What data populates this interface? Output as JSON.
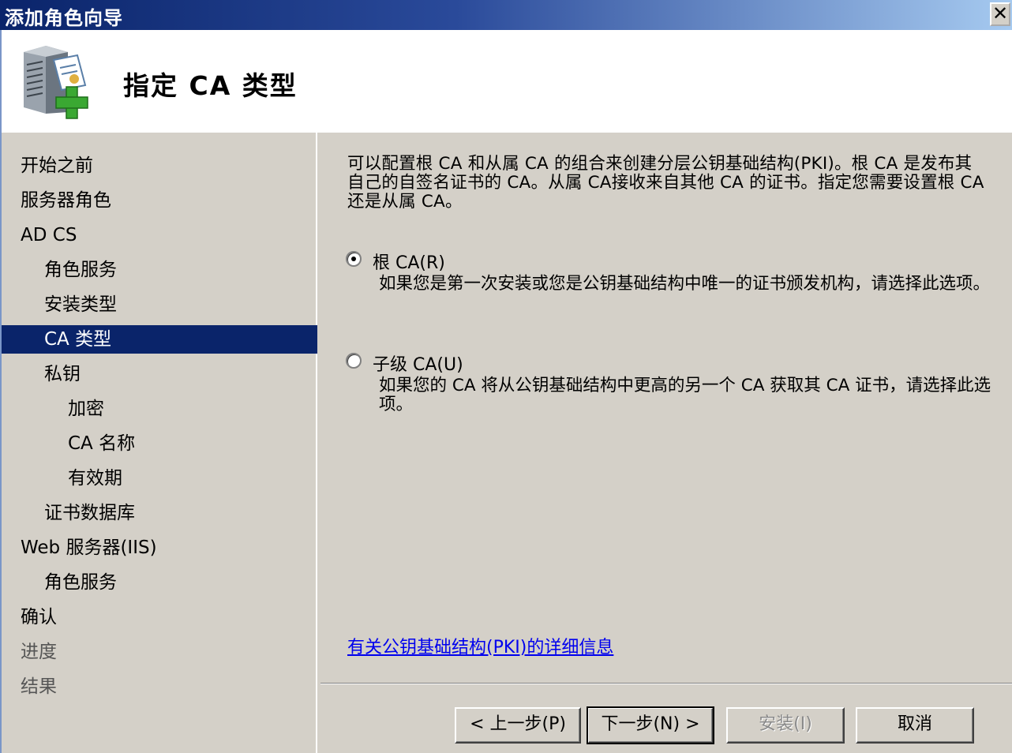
{
  "window": {
    "title": "添加角色向导",
    "close_glyph": "✕"
  },
  "header": {
    "title": "指定 CA 类型",
    "icon": "server-add-icon"
  },
  "nav": {
    "items": [
      {
        "label": "开始之前"
      },
      {
        "label": "服务器角色"
      },
      {
        "label": "AD CS"
      },
      {
        "label": "角色服务"
      },
      {
        "label": "安装类型"
      },
      {
        "label": "CA 类型"
      },
      {
        "label": "私钥"
      },
      {
        "label": "加密"
      },
      {
        "label": "CA 名称"
      },
      {
        "label": "有效期"
      },
      {
        "label": "证书数据库"
      },
      {
        "label": "Web 服务器(IIS)"
      },
      {
        "label": "角色服务"
      },
      {
        "label": "确认"
      },
      {
        "label": "进度"
      },
      {
        "label": "结果"
      }
    ]
  },
  "content": {
    "description": "可以配置根 CA 和从属 CA 的组合来创建分层公钥基础结构(PKI)。根 CA 是发布其自己的自签名证书的 CA。从属 CA接收来自其他 CA 的证书。指定您需要设置根 CA 还是从属 CA。",
    "options": [
      {
        "label": "根 CA(R)",
        "description": "如果您是第一次安装或您是公钥基础结构中唯一的证书颁发机构，请选择此选项。",
        "selected": true
      },
      {
        "label": "子级 CA(U)",
        "description": "如果您的 CA 将从公钥基础结构中更高的另一个 CA 获取其 CA 证书，请选择此选项。",
        "selected": false
      }
    ],
    "link": "有关公钥基础结构(PKI)的详细信息"
  },
  "buttons": {
    "back": "< 上一步(P)",
    "next": "下一步(N) >",
    "install": "安装(I)",
    "cancel": "取消"
  },
  "colors": {
    "title_bar_start": "#0a246a",
    "title_bar_end": "#a6caf0",
    "selection": "#0a246a",
    "link": "#0000ee",
    "face": "#d4d0c8"
  }
}
